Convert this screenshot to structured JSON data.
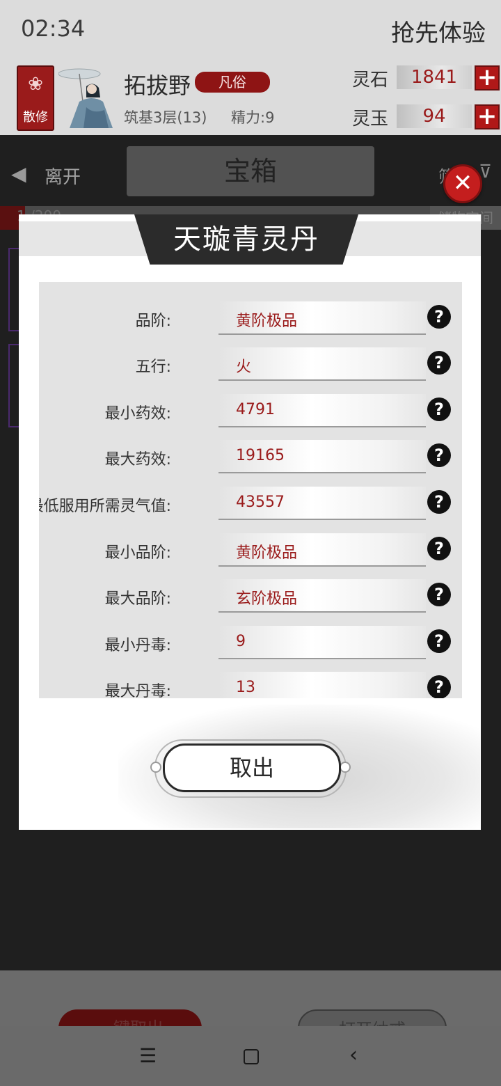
{
  "status": {
    "time": "02:34",
    "promo": "抢先体验"
  },
  "player": {
    "sect_label": "散修",
    "name": "拓拔野",
    "rank": "凡俗",
    "realm": "筑基3层(13)",
    "energy": "精力:9"
  },
  "resources": [
    {
      "label": "灵石",
      "value": "1841"
    },
    {
      "label": "灵玉",
      "value": "94"
    }
  ],
  "storage": {
    "leave_label": "离开",
    "title": "宝箱",
    "filter_label": "筛",
    "capacity": "1 /200",
    "space_label": "储物空间",
    "take_all_label": "一键取出",
    "open_ring_label": "打开纳戒"
  },
  "modal": {
    "title": "天璇青灵丹",
    "attributes": [
      {
        "label": "品阶:",
        "value": "黄阶极品"
      },
      {
        "label": "五行:",
        "value": "火"
      },
      {
        "label": "最小药效:",
        "value": "4791"
      },
      {
        "label": "最大药效:",
        "value": "19165"
      },
      {
        "label": "最低服用所需灵气值:",
        "value": "43557"
      },
      {
        "label": "最小品阶:",
        "value": "黄阶极品"
      },
      {
        "label": "最大品阶:",
        "value": "玄阶极品"
      },
      {
        "label": "最小丹毒:",
        "value": "9"
      },
      {
        "label": "最大丹毒:",
        "value": "13"
      }
    ],
    "take_out_label": "取出",
    "help_glyph": "?",
    "close_glyph": "✕"
  },
  "icons": {
    "lotus": "lotus-icon",
    "plus": "plus-icon",
    "leave": "back-arrow-icon",
    "filter": "funnel-icon",
    "help": "question-icon",
    "close": "close-icon"
  },
  "colors": {
    "accent_red": "#9a1b1b",
    "dark": "#2b2b2b"
  }
}
